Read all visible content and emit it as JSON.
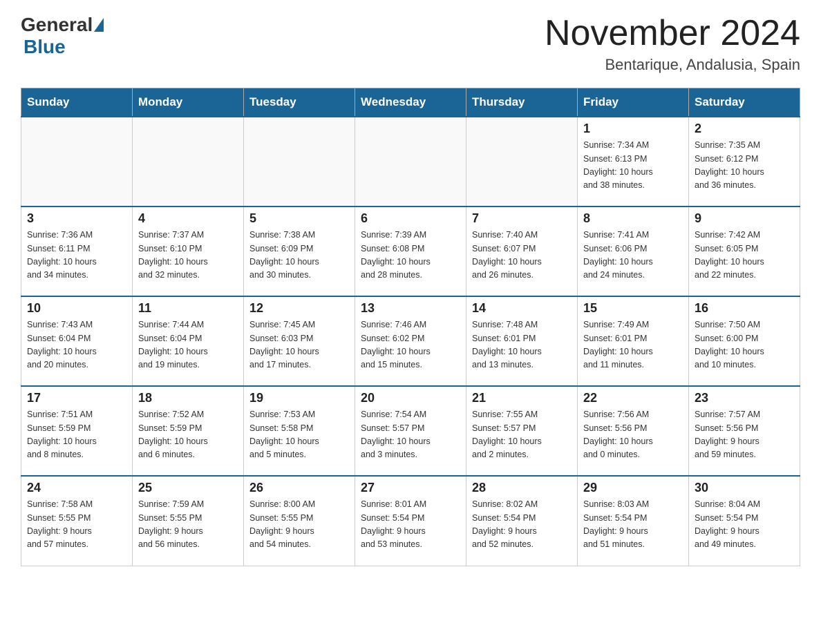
{
  "header": {
    "logo_general": "General",
    "logo_blue": "Blue",
    "month_title": "November 2024",
    "location": "Bentarique, Andalusia, Spain"
  },
  "days_of_week": [
    "Sunday",
    "Monday",
    "Tuesday",
    "Wednesday",
    "Thursday",
    "Friday",
    "Saturday"
  ],
  "weeks": [
    {
      "days": [
        {
          "number": "",
          "info": ""
        },
        {
          "number": "",
          "info": ""
        },
        {
          "number": "",
          "info": ""
        },
        {
          "number": "",
          "info": ""
        },
        {
          "number": "",
          "info": ""
        },
        {
          "number": "1",
          "info": "Sunrise: 7:34 AM\nSunset: 6:13 PM\nDaylight: 10 hours\nand 38 minutes."
        },
        {
          "number": "2",
          "info": "Sunrise: 7:35 AM\nSunset: 6:12 PM\nDaylight: 10 hours\nand 36 minutes."
        }
      ]
    },
    {
      "days": [
        {
          "number": "3",
          "info": "Sunrise: 7:36 AM\nSunset: 6:11 PM\nDaylight: 10 hours\nand 34 minutes."
        },
        {
          "number": "4",
          "info": "Sunrise: 7:37 AM\nSunset: 6:10 PM\nDaylight: 10 hours\nand 32 minutes."
        },
        {
          "number": "5",
          "info": "Sunrise: 7:38 AM\nSunset: 6:09 PM\nDaylight: 10 hours\nand 30 minutes."
        },
        {
          "number": "6",
          "info": "Sunrise: 7:39 AM\nSunset: 6:08 PM\nDaylight: 10 hours\nand 28 minutes."
        },
        {
          "number": "7",
          "info": "Sunrise: 7:40 AM\nSunset: 6:07 PM\nDaylight: 10 hours\nand 26 minutes."
        },
        {
          "number": "8",
          "info": "Sunrise: 7:41 AM\nSunset: 6:06 PM\nDaylight: 10 hours\nand 24 minutes."
        },
        {
          "number": "9",
          "info": "Sunrise: 7:42 AM\nSunset: 6:05 PM\nDaylight: 10 hours\nand 22 minutes."
        }
      ]
    },
    {
      "days": [
        {
          "number": "10",
          "info": "Sunrise: 7:43 AM\nSunset: 6:04 PM\nDaylight: 10 hours\nand 20 minutes."
        },
        {
          "number": "11",
          "info": "Sunrise: 7:44 AM\nSunset: 6:04 PM\nDaylight: 10 hours\nand 19 minutes."
        },
        {
          "number": "12",
          "info": "Sunrise: 7:45 AM\nSunset: 6:03 PM\nDaylight: 10 hours\nand 17 minutes."
        },
        {
          "number": "13",
          "info": "Sunrise: 7:46 AM\nSunset: 6:02 PM\nDaylight: 10 hours\nand 15 minutes."
        },
        {
          "number": "14",
          "info": "Sunrise: 7:48 AM\nSunset: 6:01 PM\nDaylight: 10 hours\nand 13 minutes."
        },
        {
          "number": "15",
          "info": "Sunrise: 7:49 AM\nSunset: 6:01 PM\nDaylight: 10 hours\nand 11 minutes."
        },
        {
          "number": "16",
          "info": "Sunrise: 7:50 AM\nSunset: 6:00 PM\nDaylight: 10 hours\nand 10 minutes."
        }
      ]
    },
    {
      "days": [
        {
          "number": "17",
          "info": "Sunrise: 7:51 AM\nSunset: 5:59 PM\nDaylight: 10 hours\nand 8 minutes."
        },
        {
          "number": "18",
          "info": "Sunrise: 7:52 AM\nSunset: 5:59 PM\nDaylight: 10 hours\nand 6 minutes."
        },
        {
          "number": "19",
          "info": "Sunrise: 7:53 AM\nSunset: 5:58 PM\nDaylight: 10 hours\nand 5 minutes."
        },
        {
          "number": "20",
          "info": "Sunrise: 7:54 AM\nSunset: 5:57 PM\nDaylight: 10 hours\nand 3 minutes."
        },
        {
          "number": "21",
          "info": "Sunrise: 7:55 AM\nSunset: 5:57 PM\nDaylight: 10 hours\nand 2 minutes."
        },
        {
          "number": "22",
          "info": "Sunrise: 7:56 AM\nSunset: 5:56 PM\nDaylight: 10 hours\nand 0 minutes."
        },
        {
          "number": "23",
          "info": "Sunrise: 7:57 AM\nSunset: 5:56 PM\nDaylight: 9 hours\nand 59 minutes."
        }
      ]
    },
    {
      "days": [
        {
          "number": "24",
          "info": "Sunrise: 7:58 AM\nSunset: 5:55 PM\nDaylight: 9 hours\nand 57 minutes."
        },
        {
          "number": "25",
          "info": "Sunrise: 7:59 AM\nSunset: 5:55 PM\nDaylight: 9 hours\nand 56 minutes."
        },
        {
          "number": "26",
          "info": "Sunrise: 8:00 AM\nSunset: 5:55 PM\nDaylight: 9 hours\nand 54 minutes."
        },
        {
          "number": "27",
          "info": "Sunrise: 8:01 AM\nSunset: 5:54 PM\nDaylight: 9 hours\nand 53 minutes."
        },
        {
          "number": "28",
          "info": "Sunrise: 8:02 AM\nSunset: 5:54 PM\nDaylight: 9 hours\nand 52 minutes."
        },
        {
          "number": "29",
          "info": "Sunrise: 8:03 AM\nSunset: 5:54 PM\nDaylight: 9 hours\nand 51 minutes."
        },
        {
          "number": "30",
          "info": "Sunrise: 8:04 AM\nSunset: 5:54 PM\nDaylight: 9 hours\nand 49 minutes."
        }
      ]
    }
  ]
}
